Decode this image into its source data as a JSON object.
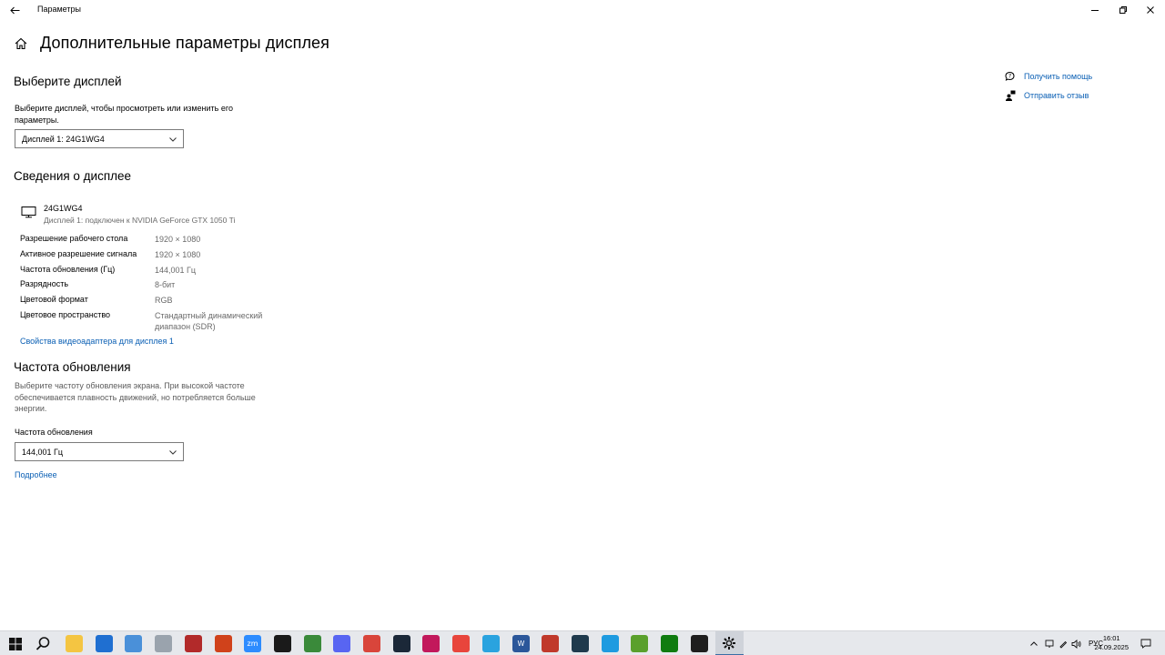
{
  "window": {
    "title": "Параметры"
  },
  "header": {
    "title": "Дополнительные параметры дисплея"
  },
  "choose_display": {
    "heading": "Выберите дисплей",
    "description": "Выберите дисплей, чтобы просмотреть или изменить его параметры.",
    "selected": "Дисплей 1: 24G1WG4"
  },
  "display_info": {
    "heading": "Сведения о дисплее",
    "name": "24G1WG4",
    "subtitle": "Дисплей 1: подключен к NVIDIA GeForce GTX 1050 Ti",
    "rows": [
      {
        "label": "Разрешение рабочего стола",
        "value": "1920 × 1080"
      },
      {
        "label": "Активное разрешение сигнала",
        "value": "1920 × 1080"
      },
      {
        "label": "Частота обновления (Гц)",
        "value": "144,001 Гц"
      },
      {
        "label": "Разрядность",
        "value": "8-бит"
      },
      {
        "label": "Цветовой формат",
        "value": "RGB"
      },
      {
        "label": "Цветовое пространство",
        "value": "Стандартный динамический диапазон (SDR)"
      }
    ],
    "adapter_link": "Свойства видеоадаптера для дисплея 1"
  },
  "refresh": {
    "heading": "Частота обновления",
    "description": "Выберите частоту обновления экрана. При высокой частоте обеспечивается плавность движений, но потребляется больше энергии.",
    "label": "Частота обновления",
    "selected": "144,001 Гц",
    "more_link": "Подробнее"
  },
  "side": {
    "help": "Получить помощь",
    "feedback": "Отправить отзыв"
  },
  "taskbar": {
    "apps": [
      {
        "name": "file-explorer-icon",
        "color": "#f4c542",
        "glyph": ""
      },
      {
        "name": "store-icon",
        "color": "#1f6fd1",
        "glyph": ""
      },
      {
        "name": "app-3-icon",
        "color": "#4a90d9",
        "glyph": ""
      },
      {
        "name": "app-4-icon",
        "color": "#9aa3ad",
        "glyph": ""
      },
      {
        "name": "app-5-icon",
        "color": "#b22a2a",
        "glyph": ""
      },
      {
        "name": "app-6-icon",
        "color": "#d0421b",
        "glyph": ""
      },
      {
        "name": "zoom-icon",
        "color": "#2d8cff",
        "glyph": "zm"
      },
      {
        "name": "nvidia-icon",
        "color": "#1a1a1a",
        "glyph": ""
      },
      {
        "name": "app-9-icon",
        "color": "#3a8a3a",
        "glyph": ""
      },
      {
        "name": "discord-icon",
        "color": "#5865f2",
        "glyph": ""
      },
      {
        "name": "app-11-icon",
        "color": "#d9453b",
        "glyph": ""
      },
      {
        "name": "steam-icon",
        "color": "#1b2838",
        "glyph": ""
      },
      {
        "name": "app-13-icon",
        "color": "#c2185b",
        "glyph": ""
      },
      {
        "name": "chrome-icon",
        "color": "#e8453c",
        "glyph": ""
      },
      {
        "name": "telegram-icon",
        "color": "#2aa3df",
        "glyph": ""
      },
      {
        "name": "word-icon",
        "color": "#2b579a",
        "glyph": "W"
      },
      {
        "name": "app-17-icon",
        "color": "#c0392b",
        "glyph": ""
      },
      {
        "name": "app-18-icon",
        "color": "#1f3a4d",
        "glyph": ""
      },
      {
        "name": "edge-icon",
        "color": "#1e9be0",
        "glyph": ""
      },
      {
        "name": "utorrent-icon",
        "color": "#5aa02c",
        "glyph": ""
      },
      {
        "name": "xbox-icon",
        "color": "#107c10",
        "glyph": ""
      },
      {
        "name": "terminal-icon",
        "color": "#1e1e1e",
        "glyph": ""
      }
    ],
    "language": "РУС",
    "time": "16:01",
    "date": "24.09.2025"
  }
}
